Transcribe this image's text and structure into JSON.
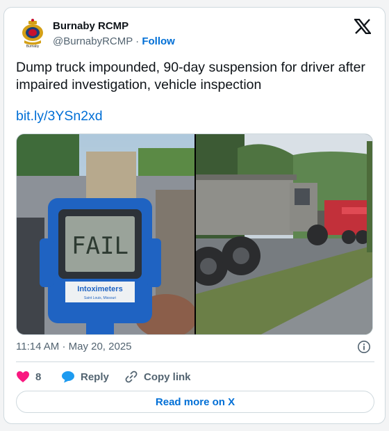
{
  "author": {
    "name": "Burnaby RCMP",
    "handle": "@BurnabyRCMP",
    "separator": "·",
    "follow_label": "Follow",
    "avatar_caption": "Burnaby"
  },
  "tweet": {
    "text": "Dump truck impounded, 90-day suspension for driver after impaired investigation, vehicle inspection",
    "link": "bit.ly/3YSn2xd"
  },
  "media": {
    "device_display_text": "FAIL",
    "device_brand": "Intoximeters",
    "device_location": "Saint Louis, Missouri"
  },
  "meta": {
    "time": "11:14 AM",
    "separator": "·",
    "date": "May 20, 2025"
  },
  "actions": {
    "like_count": "8",
    "reply_label": "Reply",
    "copy_label": "Copy link"
  },
  "footer": {
    "read_more_label": "Read more on X"
  },
  "colors": {
    "accent": "#006fd6",
    "like": "#f91880",
    "reply": "#1d9bf0",
    "text_secondary": "#536471",
    "border": "#cfd9de"
  },
  "icons": [
    "rcmp-crest-icon",
    "x-logo-icon",
    "info-icon",
    "heart-icon",
    "reply-bubble-icon",
    "link-icon"
  ]
}
